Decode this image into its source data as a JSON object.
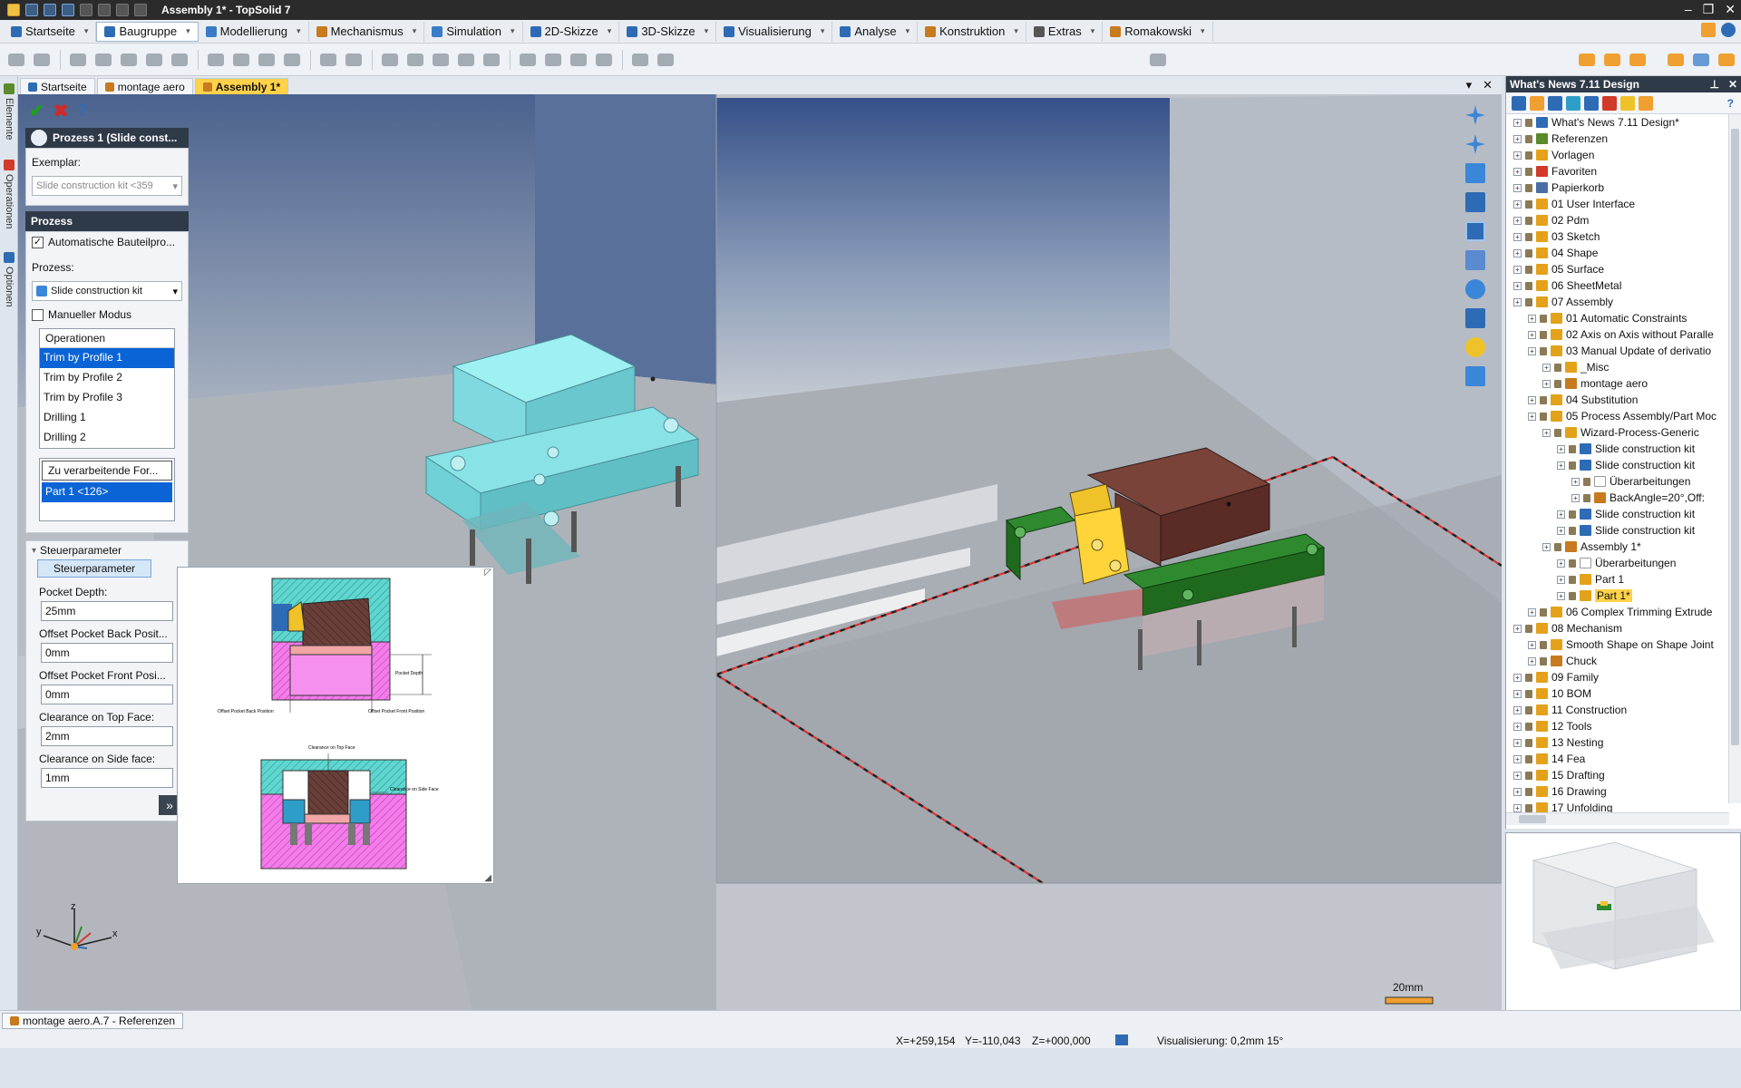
{
  "window": {
    "title": "Assembly 1* - TopSolid 7"
  },
  "menu": [
    {
      "label": "Startseite",
      "icon_color": "#2e6bb5"
    },
    {
      "label": "Baugruppe",
      "icon_color": "#2e6bb5",
      "active": true
    },
    {
      "label": "Modellierung",
      "icon_color": "#3a7bc8"
    },
    {
      "label": "Mechanismus",
      "icon_color": "#c77a1e"
    },
    {
      "label": "Simulation",
      "icon_color": "#3a7bc8"
    },
    {
      "label": "2D-Skizze",
      "icon_color": "#2e6bb5"
    },
    {
      "label": "3D-Skizze",
      "icon_color": "#2e6bb5"
    },
    {
      "label": "Visualisierung",
      "icon_color": "#2e6bb5"
    },
    {
      "label": "Analyse",
      "icon_color": "#2e6bb5"
    },
    {
      "label": "Konstruktion",
      "icon_color": "#c77a1e"
    },
    {
      "label": "Extras",
      "icon_color": "#555"
    },
    {
      "label": "Romakowski",
      "icon_color": "#c77a1e"
    }
  ],
  "doc_tabs": [
    {
      "label": "Startseite"
    },
    {
      "label": "montage aero"
    },
    {
      "label": "Assembly 1*",
      "active": true
    }
  ],
  "side_tabs": [
    "Elemente",
    "Operationen",
    "Optionen"
  ],
  "process_panel": {
    "header": "Prozess 1 (Slide const...",
    "exemplar_label": "Exemplar:",
    "exemplar_value": "Slide construction kit <359",
    "section_title": "Prozess",
    "auto_checkbox": "Automatische Bauteilpro...",
    "process_label": "Prozess:",
    "process_value": "Slide construction kit",
    "manual_checkbox": "Manueller Modus",
    "operations_header": "Operationen",
    "operations": [
      {
        "label": "Trim by Profile 1",
        "selected": true
      },
      {
        "label": "Trim by Profile 2"
      },
      {
        "label": "Trim by Profile 3"
      },
      {
        "label": "Drilling 1"
      },
      {
        "label": "Drilling 2"
      }
    ],
    "forms_header": "Zu verarbeitende For...",
    "forms_item": "Part 1 <126>",
    "param_group": "Steuerparameter",
    "param_tab": "Steuerparameter",
    "params": [
      {
        "label": "Pocket Depth:",
        "value": "25mm"
      },
      {
        "label": "Offset Pocket Back Posit...",
        "value": "0mm"
      },
      {
        "label": "Offset Pocket Front Posi...",
        "value": "0mm"
      },
      {
        "label": "Clearance on Top Face:",
        "value": "2mm"
      },
      {
        "label": "Clearance on Side face:",
        "value": "1mm"
      }
    ],
    "more_button": "»"
  },
  "preview_labels": {
    "pocket_depth": "Pocket Depth",
    "offset_back": "Offset Pocket Back Position",
    "offset_front": "Offset Pocket Front Position",
    "clearance_top": "Clearance on Top Face",
    "clearance_side": "Clearance on Side Face"
  },
  "right_panel": {
    "title": "What's News 7.11 Design",
    "tree": [
      {
        "label": "What's News 7.11 Design*",
        "level": 0,
        "color": "#2e6bb5"
      },
      {
        "label": "Referenzen",
        "level": 0,
        "color": "#5a8a2a"
      },
      {
        "label": "Vorlagen",
        "level": 0,
        "color": "#e3a21a"
      },
      {
        "label": "Favoriten",
        "level": 0,
        "color": "#d23a2a"
      },
      {
        "label": "Papierkorb",
        "level": 0,
        "color": "#4a6fa5"
      },
      {
        "label": "01 User Interface",
        "level": 0,
        "color": "#e3a21a"
      },
      {
        "label": "02 Pdm",
        "level": 0,
        "color": "#e3a21a"
      },
      {
        "label": "03 Sketch",
        "level": 0,
        "color": "#e3a21a"
      },
      {
        "label": "04 Shape",
        "level": 0,
        "color": "#e3a21a"
      },
      {
        "label": "05 Surface",
        "level": 0,
        "color": "#e3a21a"
      },
      {
        "label": "06 SheetMetal",
        "level": 0,
        "color": "#e3a21a"
      },
      {
        "label": "07 Assembly",
        "level": 0,
        "color": "#e3a21a"
      },
      {
        "label": "01 Automatic Constraints",
        "level": 1,
        "color": "#e3a21a"
      },
      {
        "label": "02 Axis on Axis without Paralle",
        "level": 1,
        "color": "#e3a21a"
      },
      {
        "label": "03 Manual Update of derivatio",
        "level": 1,
        "color": "#e3a21a"
      },
      {
        "label": "_Misc",
        "level": 2,
        "color": "#e3a21a"
      },
      {
        "label": "montage aero",
        "level": 2,
        "color": "#c77a1e"
      },
      {
        "label": "04 Substitution",
        "level": 1,
        "color": "#e3a21a"
      },
      {
        "label": "05 Process Assembly/Part Moc",
        "level": 1,
        "color": "#e3a21a"
      },
      {
        "label": "Wizard-Process-Generic",
        "level": 2,
        "color": "#e3a21a"
      },
      {
        "label": "Slide construction kit",
        "level": 3,
        "color": "#2e6bb5"
      },
      {
        "label": "Slide construction kit",
        "level": 3,
        "color": "#2e6bb5"
      },
      {
        "label": "Überarbeitungen",
        "level": 4,
        "color": "#ffffff"
      },
      {
        "label": "BackAngle=20°,Off:",
        "level": 4,
        "color": "#c77a1e"
      },
      {
        "label": "Slide construction kit",
        "level": 3,
        "color": "#2e6bb5"
      },
      {
        "label": "Slide construction kit",
        "level": 3,
        "color": "#2e6bb5"
      },
      {
        "label": "Assembly 1*",
        "level": 2,
        "color": "#c77a1e"
      },
      {
        "label": "Überarbeitungen",
        "level": 3,
        "color": "#ffffff"
      },
      {
        "label": "Part 1",
        "level": 3,
        "color": "#e3a21a"
      },
      {
        "label": "Part 1*",
        "level": 3,
        "color": "#e3a21a",
        "highlight": true
      },
      {
        "label": "06 Complex Trimming Extrude",
        "level": 1,
        "color": "#e3a21a"
      },
      {
        "label": "08 Mechanism",
        "level": 0,
        "color": "#e3a21a"
      },
      {
        "label": "Smooth Shape on Shape Joint",
        "level": 1,
        "color": "#e3a21a"
      },
      {
        "label": "Chuck",
        "level": 1,
        "color": "#c77a1e"
      },
      {
        "label": "09 Family",
        "level": 0,
        "color": "#e3a21a"
      },
      {
        "label": "10 BOM",
        "level": 0,
        "color": "#e3a21a"
      },
      {
        "label": "11 Construction",
        "level": 0,
        "color": "#e3a21a"
      },
      {
        "label": "12 Tools",
        "level": 0,
        "color": "#e3a21a"
      },
      {
        "label": "13 Nesting",
        "level": 0,
        "color": "#e3a21a"
      },
      {
        "label": "14 Fea",
        "level": 0,
        "color": "#e3a21a"
      },
      {
        "label": "15 Drafting",
        "level": 0,
        "color": "#e3a21a"
      },
      {
        "label": "16 Drawing",
        "level": 0,
        "color": "#e3a21a"
      },
      {
        "label": "17 Unfolding",
        "level": 0,
        "color": "#e3a21a"
      }
    ]
  },
  "viewport": {
    "scale_label": "20mm",
    "axes": {
      "x": "x",
      "y": "y",
      "z": "z"
    }
  },
  "status": {
    "tab": "montage aero.A.7 - Referenzen",
    "x": "X=+259,154",
    "y": "Y=-110,043",
    "z": "Z=+000,000",
    "visual": "Visualisierung: 0,2mm 15°"
  },
  "colors": {
    "accent_orange": "#f0a030",
    "selection_blue": "#0a64d6",
    "panel_dark": "#2f3a49",
    "tab_active": "#ffd24a",
    "cyan_part": "#8fe3e8",
    "brown_part": "#6b3b33",
    "green_part": "#2c7a2c",
    "yellow_part": "#f0c22a"
  }
}
